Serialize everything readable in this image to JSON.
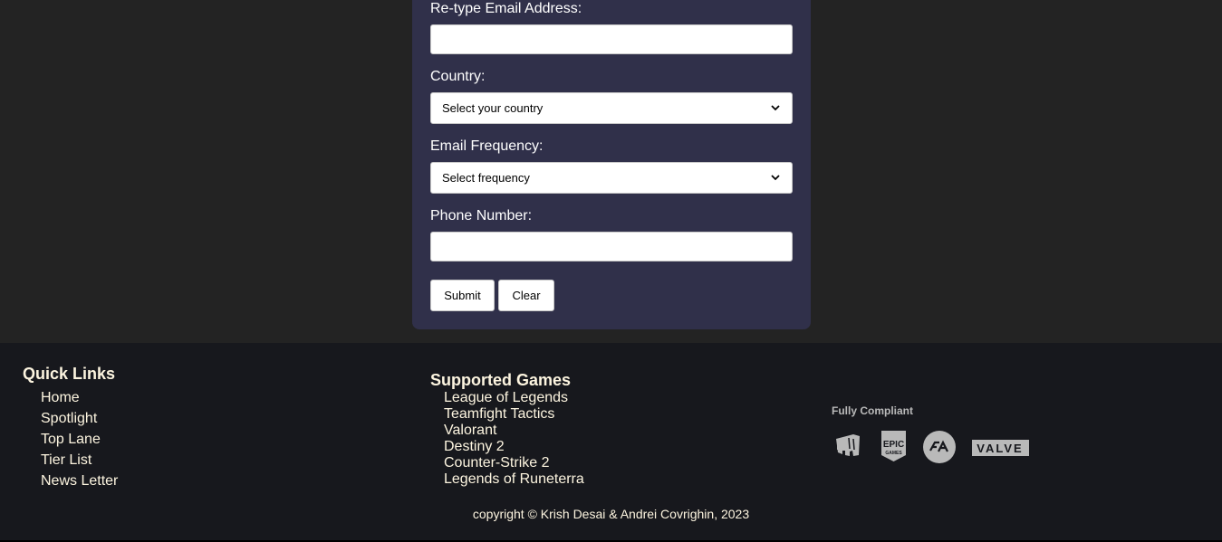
{
  "form": {
    "retype_email_label": "Re-type Email Address:",
    "retype_email_value": "",
    "country_label": "Country:",
    "country_selected": "Select your country",
    "frequency_label": "Email Frequency:",
    "frequency_selected": "Select frequency",
    "phone_label": "Phone Number:",
    "phone_value": "",
    "submit_label": "Submit",
    "clear_label": "Clear"
  },
  "footer": {
    "quick_links": {
      "title": "Quick Links",
      "items": [
        "Home",
        "Spotlight",
        "Top Lane",
        "Tier List",
        "News Letter"
      ]
    },
    "supported_games": {
      "title": "Supported Games",
      "items": [
        "League of Legends",
        "Teamfight Tactics",
        "Valorant",
        "Destiny 2",
        "Counter-Strike 2",
        "Legends of Runeterra"
      ]
    },
    "compliance": {
      "title": "Fully Compliant",
      "logos": [
        "riot-games-logo",
        "epic-games-logo",
        "ea-logo",
        "valve-logo"
      ]
    },
    "copyright": "copyright © Krish Desai & Andrei Covrighin, 2023"
  },
  "colors": {
    "page_bg": "#232323",
    "form_bg": "#30304a",
    "footer_bg": "#17181d",
    "footer_text": "#fdf5e0",
    "logo_gray": "#b9b9b9"
  }
}
